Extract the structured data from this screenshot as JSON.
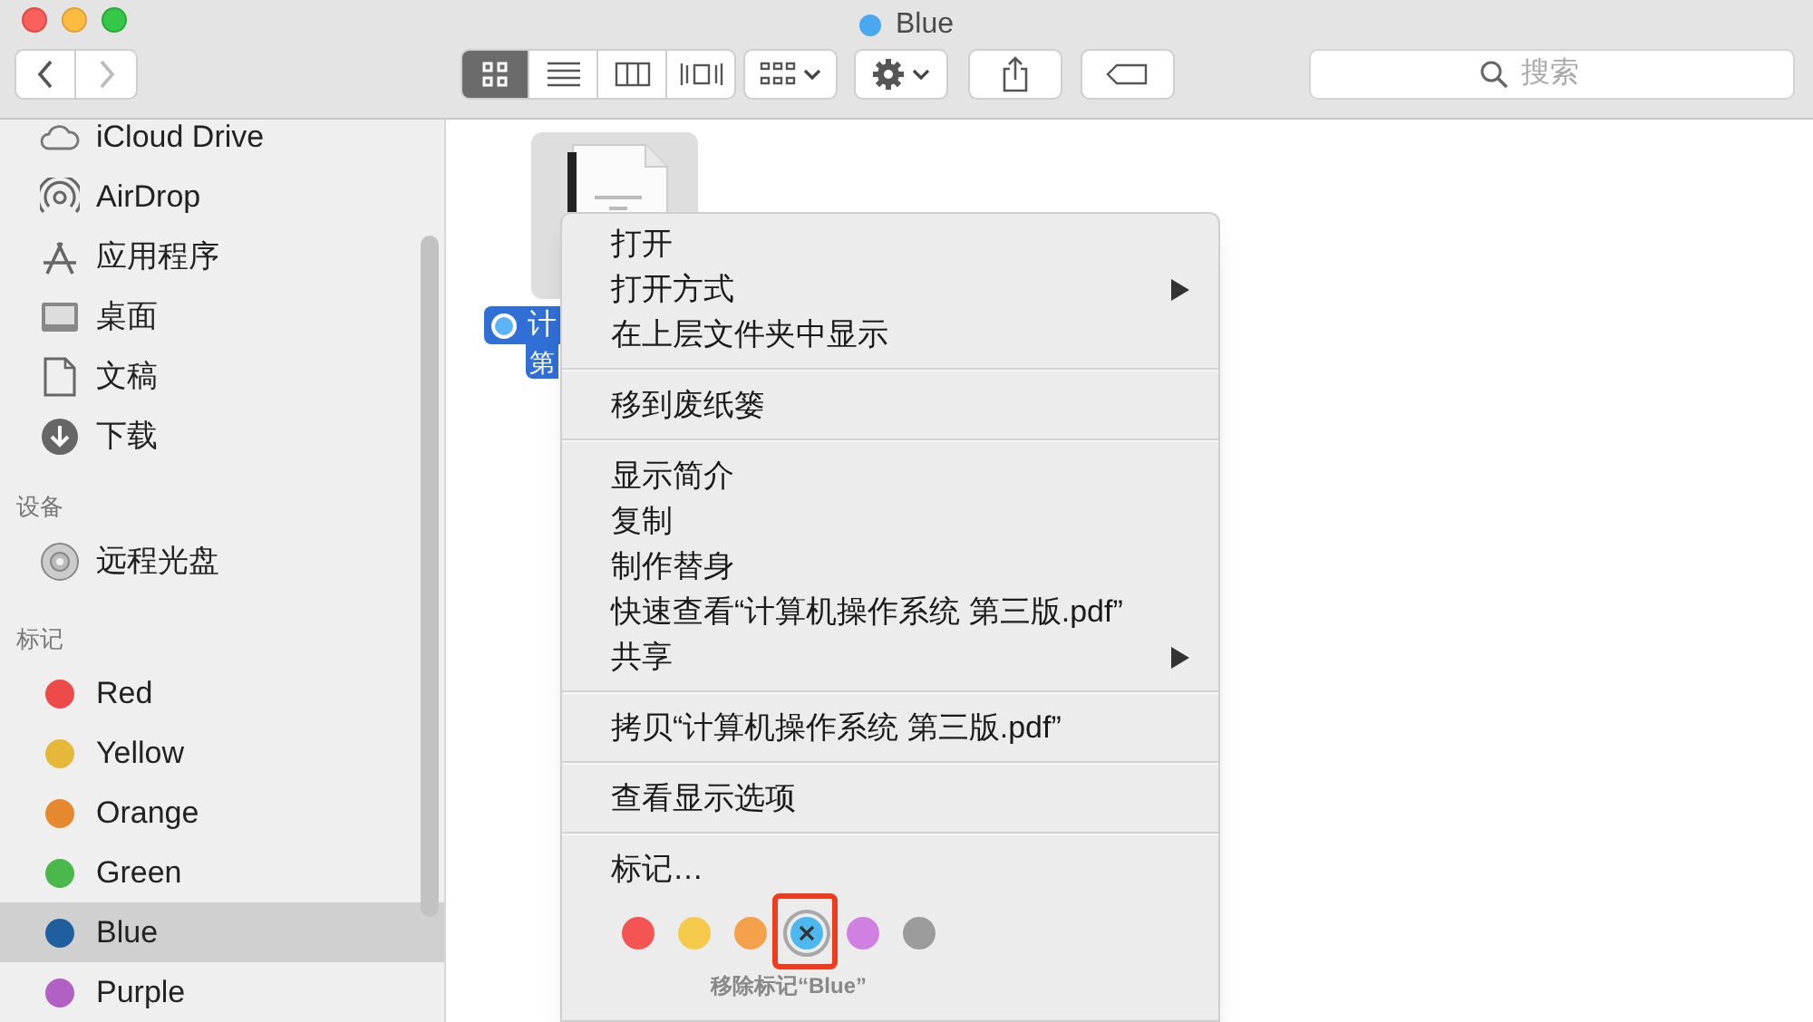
{
  "window": {
    "title": "Blue"
  },
  "toolbar": {
    "view_buttons": [
      {
        "kind": "icons",
        "selected": true
      },
      {
        "kind": "list",
        "selected": false
      },
      {
        "kind": "columns",
        "selected": false
      },
      {
        "kind": "coverflow",
        "selected": false
      }
    ],
    "search": {
      "placeholder": "搜索"
    }
  },
  "sidebar": {
    "favorites": [
      {
        "label": "iCloud Drive",
        "kind": "cloud"
      },
      {
        "label": "AirDrop",
        "kind": "airdrop"
      },
      {
        "label": "应用程序",
        "kind": "apps"
      },
      {
        "label": "桌面",
        "kind": "desktop"
      },
      {
        "label": "文稿",
        "kind": "document"
      },
      {
        "label": "下载",
        "kind": "download"
      }
    ],
    "devices": {
      "heading": "设备",
      "items": [
        {
          "label": "远程光盘",
          "kind": "disc"
        }
      ]
    },
    "tags": {
      "heading": "标记",
      "items": [
        {
          "label": "Red",
          "color": "#ef4a4a",
          "selected": false
        },
        {
          "label": "Yellow",
          "color": "#e6b83a",
          "selected": false
        },
        {
          "label": "Orange",
          "color": "#e6892e",
          "selected": false
        },
        {
          "label": "Green",
          "color": "#4bb84b",
          "selected": false
        },
        {
          "label": "Blue",
          "color": "#1f5f9f",
          "selected": true
        },
        {
          "label": "Purple",
          "color": "#b160c4",
          "selected": false
        }
      ]
    }
  },
  "file": {
    "name_lines": [
      "计",
      "第"
    ],
    "selected": true
  },
  "context_menu": {
    "groups": [
      [
        {
          "label": "打开",
          "submenu": false
        },
        {
          "label": "打开方式",
          "submenu": true
        },
        {
          "label": "在上层文件夹中显示",
          "submenu": false
        }
      ],
      [
        {
          "label": "移到废纸篓",
          "submenu": false
        }
      ],
      [
        {
          "label": "显示简介",
          "submenu": false
        },
        {
          "label": "复制",
          "submenu": false
        },
        {
          "label": "制作替身",
          "submenu": false
        },
        {
          "label": "快速查看“计算机操作系统 第三版.pdf”",
          "submenu": false
        },
        {
          "label": "共享",
          "submenu": true
        }
      ],
      [
        {
          "label": "拷贝“计算机操作系统 第三版.pdf”",
          "submenu": false
        }
      ],
      [
        {
          "label": "查看显示选项",
          "submenu": false
        }
      ]
    ],
    "tags_label": "标记…",
    "tag_colors": [
      {
        "color": "#f55454",
        "selected": false
      },
      {
        "color": "#f5c94a",
        "selected": false
      },
      {
        "color": "#f5a04a",
        "selected": false
      },
      {
        "color": "#4db8f0",
        "selected": true
      },
      {
        "color": "#cf80e0",
        "selected": false
      },
      {
        "color": "#9b9b9b",
        "selected": false
      }
    ],
    "tag_tooltip": "移除标记“Blue”"
  }
}
